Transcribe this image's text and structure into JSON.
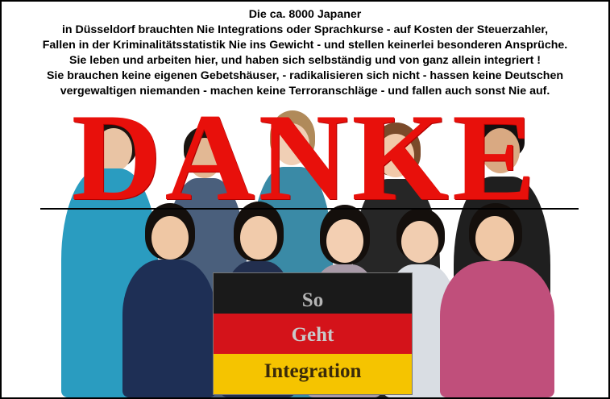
{
  "intro": {
    "lines": [
      "Die ca. 8000 Japaner",
      "in Düsseldorf brauchten Nie  Integrations oder Sprachkurse  - auf Kosten der Steuerzahler,",
      "Fallen in der Kriminalitätsstatistik Nie ins Gewicht - und stellen keinerlei besonderen Ansprüche.",
      "Sie leben und arbeiten hier, und haben sich selbständig und von ganz allein integriert !",
      "Sie brauchen keine eigenen Gebetshäuser,  - radikalisieren sich nicht - hassen keine Deutschen",
      "vergewaltigen niemanden - machen keine Terroranschläge - und fallen auch sonst Nie auf."
    ]
  },
  "headline": "DANKE",
  "flag": {
    "line1": "So",
    "line2": "Geht",
    "line3": "Integration",
    "colors": {
      "black": "#1a1a1a",
      "red": "#d4131a",
      "gold": "#f5c400"
    }
  },
  "colors": {
    "danke_red": "#e8100b"
  }
}
